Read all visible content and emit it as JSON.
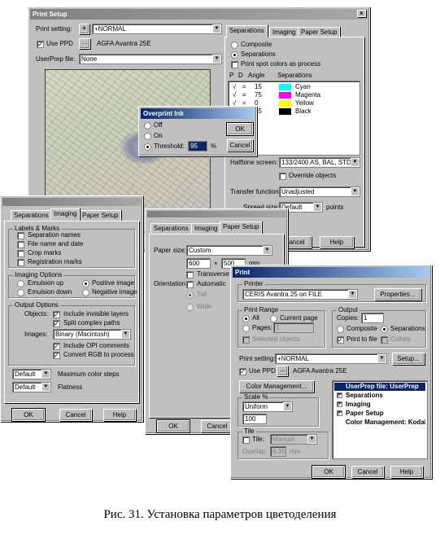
{
  "print_setup": {
    "title": "Print Setup",
    "close": "x",
    "print_setting_label": "Print setting:",
    "print_setting_value": "+NORMAL",
    "use_ppd_label": "Use PPD",
    "ppd_button": "...",
    "ppd_value": "AGFA Avantra 25E",
    "userprep_label": "UserPrep file:",
    "userprep_value": "None",
    "tabs": [
      "Separations",
      "Imaging",
      "Paper Setup"
    ],
    "composite_label": "Composite",
    "separations_label": "Separations",
    "spot_label": "Print spot colors as process",
    "col_headers": [
      "P",
      "D",
      "Angle",
      "Separations"
    ],
    "inks": [
      {
        "p": "√",
        "angle": "15",
        "name": "Cyan",
        "color": "#00ffff"
      },
      {
        "p": "√",
        "angle": "75",
        "name": "Magenta",
        "color": "#ff00ff"
      },
      {
        "p": "√",
        "angle": "0",
        "name": "Yellow",
        "color": "#ffff00"
      },
      {
        "p": "√",
        "angle": "45",
        "name": "Black",
        "color": "#000000"
      }
    ],
    "halftone_label": "Halftone screen:",
    "halftone_value": "133/2400 AS, BAL, STD",
    "override_label": "Override objects",
    "transfer_label": "Transfer function:",
    "transfer_value": "Unadjusted",
    "spread_label": "Spread size:",
    "spread_value": "Default",
    "spread_unit": "points",
    "cancel": "Cancel",
    "help": "Help"
  },
  "overprint": {
    "title": "Overprint Ink",
    "off": "Off",
    "on": "On",
    "threshold": "Threshold:",
    "threshold_value": "95",
    "percent": "%",
    "ok": "OK",
    "cancel": "Cancel"
  },
  "imaging": {
    "tabs": [
      "Separations",
      "Imaging",
      "Paper Setup"
    ],
    "labels_group": "Labels & Marks",
    "labels": [
      "Separation names",
      "File name and date",
      "Crop marks",
      "Registration marks"
    ],
    "imaging_group": "Imaging Options",
    "emulsion_up": "Emulsion up",
    "emulsion_down": "Emulsion down",
    "positive": "Positive image",
    "negative": "Negative image",
    "output_group": "Output Options",
    "objects_label": "Objects:",
    "invisible": "Include invisible layers",
    "split": "Split complex paths",
    "images_label": "Images:",
    "images_value": "Binary (Macintosh)",
    "opi": "Include OPI comments",
    "rgb": "Convert RGB to process",
    "max_color_value": "Default",
    "max_color_label": "Maximum color steps",
    "flatness_value": "Default",
    "flatness_label": "Flatness",
    "ok": "OK",
    "cancel": "Cancel",
    "help": "Help"
  },
  "paper": {
    "tabs": [
      "Separations",
      "Imaging",
      "Paper Setup"
    ],
    "paper_size_label": "Paper size:",
    "paper_size_value": "Custom",
    "width": "600",
    "times": "×",
    "height": "500",
    "unit": "mm",
    "orientation_label": "Orientation:",
    "transverse": "Transverse",
    "automatic": "Automatic",
    "tall": "Tall",
    "wide": "Wide",
    "ok": "OK",
    "cancel": "Cancel"
  },
  "print": {
    "title": "Print",
    "printer_group": "Printer",
    "printer_value": "CERIS Avantra 25 on FILE",
    "properties": "Properties...",
    "range_group": "Print Range",
    "all": "All",
    "current": "Current page",
    "pages": "Pages:",
    "pages_value": "1",
    "selected": "Selected objects",
    "output_group": "Output",
    "copies_label": "Copies:",
    "copies_value": "1",
    "composite": "Composite",
    "separations": "Separations",
    "print_to_file": "Print to file",
    "collate": "Collate",
    "setting_label": "Print setting:",
    "setting_value": "+NORMAL",
    "setup": "Setup...",
    "use_ppd": "Use PPD",
    "ppd_btn": "...",
    "ppd_value": "AGFA Avantra 25E",
    "color_mgmt": "Color Management...",
    "scale_group": "Scale %",
    "scale_value": "Uniform",
    "scale_number": "100",
    "tile_group": "Tile",
    "tile_label": "Tile:",
    "tile_value": "Manual",
    "overlap_label": "Overlap:",
    "overlap_value": "6.35",
    "overlap_unit": "mm",
    "tree": [
      {
        "label": "UserPrep file: UserPrep",
        "bold": true,
        "sel": true,
        "exp": ""
      },
      {
        "label": "Separations",
        "bold": true,
        "sel": false,
        "exp": "+"
      },
      {
        "label": "Imaging",
        "bold": true,
        "sel": false,
        "exp": "+"
      },
      {
        "label": "Paper Setup",
        "bold": true,
        "sel": false,
        "exp": "+"
      },
      {
        "label": "Color Management: Kodak",
        "bold": true,
        "sel": false,
        "exp": ""
      }
    ],
    "ok": "OK",
    "cancel": "Cancel",
    "help": "Help"
  },
  "caption": "Рис. 31. Установка параметров цветоделения"
}
